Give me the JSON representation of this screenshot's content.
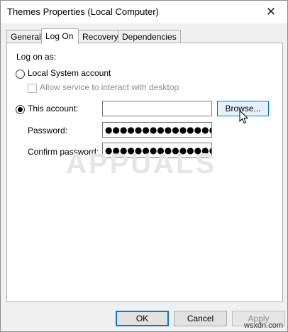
{
  "window": {
    "title": "Themes Properties (Local Computer)"
  },
  "tabs": [
    {
      "label": "General",
      "active": false
    },
    {
      "label": "Log On",
      "active": true
    },
    {
      "label": "Recovery",
      "active": false
    },
    {
      "label": "Dependencies",
      "active": false
    }
  ],
  "logon": {
    "heading": "Log on as:",
    "local_system": {
      "label": "Local System account",
      "checked": false
    },
    "interact_desktop": {
      "label": "Allow service to interact with desktop",
      "checked": false,
      "disabled": true
    },
    "this_account": {
      "label": "This account:",
      "checked": true,
      "value": ""
    },
    "browse_label": "Browse...",
    "password": {
      "label": "Password:",
      "value": "●●●●●●●●●●●●●●●"
    },
    "confirm_password": {
      "label": "Confirm password:",
      "value": "●●●●●●●●●●●●●●●"
    }
  },
  "footer": {
    "ok_label": "OK",
    "cancel_label": "Cancel",
    "apply_label": "Apply"
  },
  "watermark": {
    "text": "APPUALS"
  },
  "site": "wsxdn.com",
  "colors": {
    "accent": "#0078d7",
    "disabled_text": "#8d8d8d"
  }
}
